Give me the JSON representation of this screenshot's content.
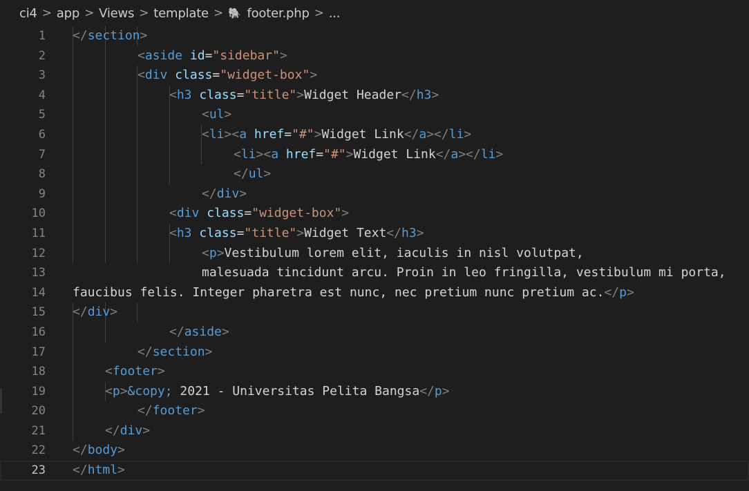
{
  "breadcrumb": {
    "items": [
      "ci4",
      "app",
      "Views",
      "template",
      "footer.php",
      "..."
    ],
    "separator": ">"
  },
  "colors": {
    "background": "#1e1e1e",
    "tag": "#569cd6",
    "attribute": "#9cdcfe",
    "string": "#ce9178",
    "text": "#d4d4d4",
    "punctuation": "#808080",
    "line_number": "#858585",
    "php_icon": "#a074c4"
  },
  "icons": {
    "file": "php-elephant-icon"
  },
  "editor": {
    "active_line": 23,
    "lines": [
      {
        "n": "1",
        "tokens": [
          [
            "p",
            "</"
          ],
          [
            "t",
            "section"
          ],
          [
            "p",
            ">"
          ]
        ]
      },
      {
        "n": "2",
        "tokens": [
          [
            "p",
            "<"
          ],
          [
            "t",
            "aside"
          ],
          [
            "d",
            " "
          ],
          [
            "a",
            "id"
          ],
          [
            "d",
            "="
          ],
          [
            "s",
            "\"sidebar\""
          ],
          [
            "p",
            ">"
          ]
        ]
      },
      {
        "n": "3",
        "tokens": [
          [
            "p",
            "<"
          ],
          [
            "t",
            "div"
          ],
          [
            "d",
            " "
          ],
          [
            "a",
            "class"
          ],
          [
            "d",
            "="
          ],
          [
            "s",
            "\"widget-box\""
          ],
          [
            "p",
            ">"
          ]
        ]
      },
      {
        "n": "4",
        "tokens": [
          [
            "p",
            "<"
          ],
          [
            "t",
            "h3"
          ],
          [
            "d",
            " "
          ],
          [
            "a",
            "class"
          ],
          [
            "d",
            "="
          ],
          [
            "s",
            "\"title\""
          ],
          [
            "p",
            ">"
          ],
          [
            "d",
            "Widget Header"
          ],
          [
            "p",
            "</"
          ],
          [
            "t",
            "h3"
          ],
          [
            "p",
            ">"
          ]
        ]
      },
      {
        "n": "5",
        "tokens": [
          [
            "p",
            "<"
          ],
          [
            "t",
            "ul"
          ],
          [
            "p",
            ">"
          ]
        ]
      },
      {
        "n": "6",
        "tokens": [
          [
            "p",
            "<"
          ],
          [
            "t",
            "li"
          ],
          [
            "p",
            "><"
          ],
          [
            "t",
            "a"
          ],
          [
            "d",
            " "
          ],
          [
            "a",
            "href"
          ],
          [
            "d",
            "="
          ],
          [
            "s",
            "\"#\""
          ],
          [
            "p",
            ">"
          ],
          [
            "d",
            "Widget Link"
          ],
          [
            "p",
            "</"
          ],
          [
            "t",
            "a"
          ],
          [
            "p",
            "></"
          ],
          [
            "t",
            "li"
          ],
          [
            "p",
            ">"
          ]
        ]
      },
      {
        "n": "7",
        "tokens": [
          [
            "p",
            "<"
          ],
          [
            "t",
            "li"
          ],
          [
            "p",
            "><"
          ],
          [
            "t",
            "a"
          ],
          [
            "d",
            " "
          ],
          [
            "a",
            "href"
          ],
          [
            "d",
            "="
          ],
          [
            "s",
            "\"#\""
          ],
          [
            "p",
            ">"
          ],
          [
            "d",
            "Widget Link"
          ],
          [
            "p",
            "</"
          ],
          [
            "t",
            "a"
          ],
          [
            "p",
            "></"
          ],
          [
            "t",
            "li"
          ],
          [
            "p",
            ">"
          ]
        ]
      },
      {
        "n": "8",
        "tokens": [
          [
            "p",
            "</"
          ],
          [
            "t",
            "ul"
          ],
          [
            "p",
            ">"
          ]
        ]
      },
      {
        "n": "9",
        "tokens": [
          [
            "p",
            "</"
          ],
          [
            "t",
            "div"
          ],
          [
            "p",
            ">"
          ]
        ]
      },
      {
        "n": "10",
        "tokens": [
          [
            "p",
            "<"
          ],
          [
            "t",
            "div"
          ],
          [
            "d",
            " "
          ],
          [
            "a",
            "class"
          ],
          [
            "d",
            "="
          ],
          [
            "s",
            "\"widget-box\""
          ],
          [
            "p",
            ">"
          ]
        ]
      },
      {
        "n": "11",
        "tokens": [
          [
            "p",
            "<"
          ],
          [
            "t",
            "h3"
          ],
          [
            "d",
            " "
          ],
          [
            "a",
            "class"
          ],
          [
            "d",
            "="
          ],
          [
            "s",
            "\"title\""
          ],
          [
            "p",
            ">"
          ],
          [
            "d",
            "Widget Text"
          ],
          [
            "p",
            "</"
          ],
          [
            "t",
            "h3"
          ],
          [
            "p",
            ">"
          ]
        ]
      },
      {
        "n": "12",
        "tokens": [
          [
            "p",
            "<"
          ],
          [
            "t",
            "p"
          ],
          [
            "p",
            ">"
          ],
          [
            "d",
            "Vestibulum lorem elit, iaculis in nisl volutpat,"
          ]
        ]
      },
      {
        "n": "13",
        "tokens": [
          [
            "d",
            "malesuada tincidunt arcu. Proin in leo fringilla, vestibulum mi porta,"
          ]
        ]
      },
      {
        "n": "14",
        "tokens": [
          [
            "d",
            "faucibus felis. Integer pharetra est nunc, nec pretium nunc pretium ac."
          ],
          [
            "p",
            "</"
          ],
          [
            "t",
            "p"
          ],
          [
            "p",
            ">"
          ]
        ]
      },
      {
        "n": "15",
        "tokens": [
          [
            "p",
            "</"
          ],
          [
            "t",
            "div"
          ],
          [
            "p",
            ">"
          ]
        ]
      },
      {
        "n": "16",
        "tokens": [
          [
            "p",
            "</"
          ],
          [
            "t",
            "aside"
          ],
          [
            "p",
            ">"
          ]
        ]
      },
      {
        "n": "17",
        "tokens": [
          [
            "p",
            "</"
          ],
          [
            "t",
            "section"
          ],
          [
            "p",
            ">"
          ]
        ]
      },
      {
        "n": "18",
        "tokens": [
          [
            "p",
            "<"
          ],
          [
            "t",
            "footer"
          ],
          [
            "p",
            ">"
          ]
        ]
      },
      {
        "n": "19",
        "tokens": [
          [
            "p",
            "<"
          ],
          [
            "t",
            "p"
          ],
          [
            "p",
            ">"
          ],
          [
            "e",
            "&copy;"
          ],
          [
            "d",
            " 2021 - Universitas Pelita Bangsa"
          ],
          [
            "p",
            "</"
          ],
          [
            "t",
            "p"
          ],
          [
            "p",
            ">"
          ]
        ]
      },
      {
        "n": "20",
        "tokens": [
          [
            "p",
            "</"
          ],
          [
            "t",
            "footer"
          ],
          [
            "p",
            ">"
          ]
        ]
      },
      {
        "n": "21",
        "tokens": [
          [
            "p",
            "</"
          ],
          [
            "t",
            "div"
          ],
          [
            "p",
            ">"
          ]
        ]
      },
      {
        "n": "22",
        "tokens": [
          [
            "p",
            "</"
          ],
          [
            "t",
            "body"
          ],
          [
            "p",
            ">"
          ]
        ]
      },
      {
        "n": "23",
        "tokens": [
          [
            "p",
            "</"
          ],
          [
            "t",
            "html"
          ],
          [
            "p",
            ">"
          ]
        ]
      }
    ]
  }
}
